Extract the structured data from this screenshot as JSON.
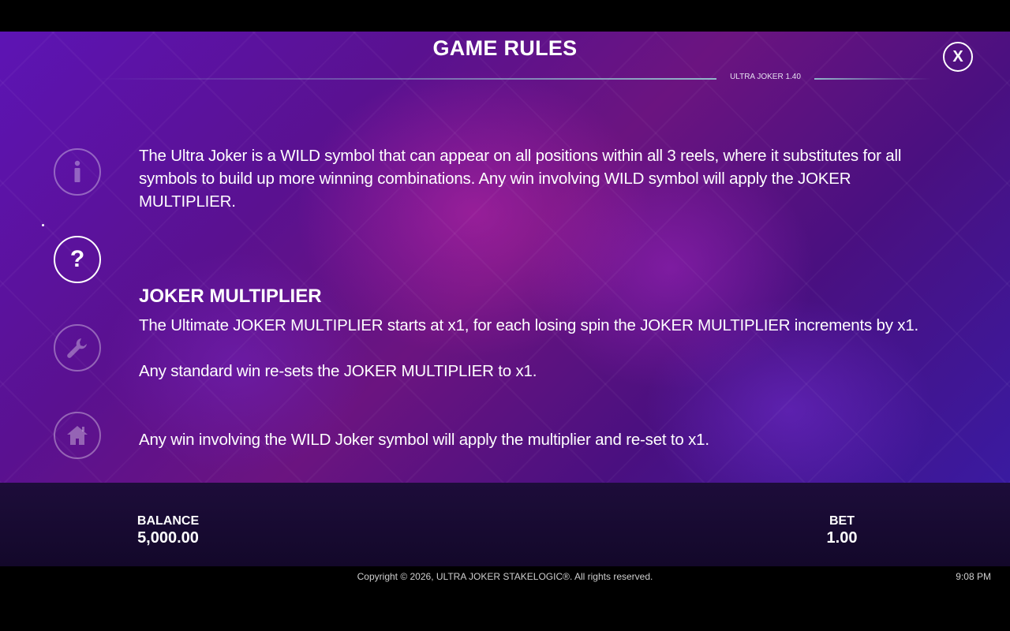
{
  "header": {
    "title": "GAME RULES",
    "version": "ULTRA JOKER 1.40",
    "close_label": "X"
  },
  "nav": {
    "items": [
      {
        "name": "info",
        "icon": "info-icon",
        "active": false
      },
      {
        "name": "rules",
        "icon": "question-icon",
        "active": true
      },
      {
        "name": "settings",
        "icon": "wrench-icon",
        "active": false
      },
      {
        "name": "home",
        "icon": "home-icon",
        "active": false
      }
    ]
  },
  "rules": {
    "intro": "The Ultra Joker is a WILD symbol that can appear on all positions within all 3 reels, where it substitutes for all symbols to build up more winning combinations. Any win involving WILD symbol will apply the JOKER MULTIPLIER.",
    "section_heading": "JOKER MULTIPLIER",
    "paragraphs": [
      "The Ultimate JOKER MULTIPLIER starts at x1, for each losing spin the JOKER MULTIPLIER increments by x1.",
      "Any standard win re-sets the JOKER MULTIPLIER to x1.",
      "Any win involving the WILD Joker symbol will apply the multiplier and re-set to x1."
    ]
  },
  "footer": {
    "balance_label": "BALANCE",
    "balance_value": "5,000.00",
    "bet_label": "BET",
    "bet_value": "1.00"
  },
  "system": {
    "copyright": "Copyright © 2026, ULTRA JOKER STAKELOGIC®. All rights reserved.",
    "time": "9:08 PM"
  },
  "colors": {
    "background_purple": "#5a1190",
    "footer_bg": "#1d0d3a",
    "accent_line": "#96c8d2"
  }
}
